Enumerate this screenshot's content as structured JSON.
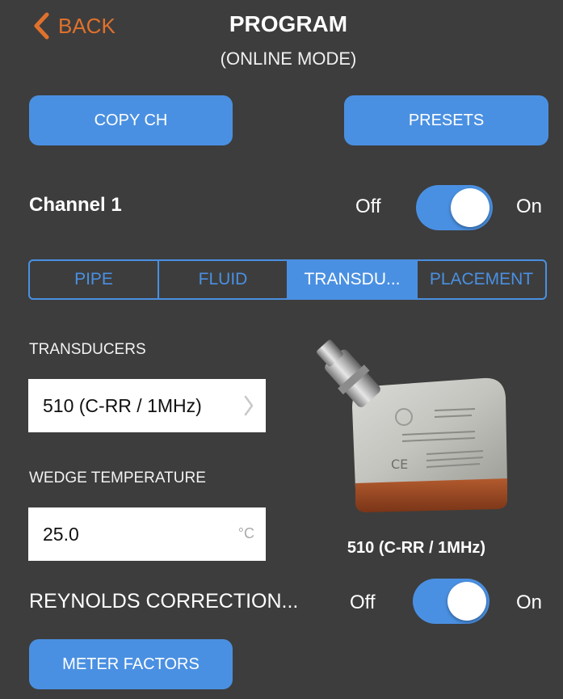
{
  "header": {
    "back_label": "BACK",
    "title": "PROGRAM",
    "subtitle": "(ONLINE MODE)"
  },
  "actions": {
    "copy_label": "COPY CH",
    "presets_label": "PRESETS",
    "meter_factors_label": "METER FACTORS"
  },
  "channel": {
    "label": "Channel 1",
    "off_label": "Off",
    "on_label": "On",
    "enabled": true
  },
  "tabs": [
    {
      "label": "PIPE",
      "active": false
    },
    {
      "label": "FLUID",
      "active": false
    },
    {
      "label": "TRANSDU...",
      "active": true
    },
    {
      "label": "PLACEMENT",
      "active": false
    }
  ],
  "transducers": {
    "section_label": "TRANSDUCERS",
    "selected_value": "510 (C-RR / 1MHz)",
    "image_caption": "510 (C-RR / 1MHz)"
  },
  "wedge": {
    "section_label": "WEDGE TEMPERATURE",
    "value": "25.0",
    "unit": "°C"
  },
  "reynolds": {
    "label": "REYNOLDS CORRECTION...",
    "off_label": "Off",
    "on_label": "On",
    "enabled": true
  },
  "colors": {
    "background": "#3d3d3d",
    "accent": "#4a90e2",
    "back": "#e0712c"
  }
}
